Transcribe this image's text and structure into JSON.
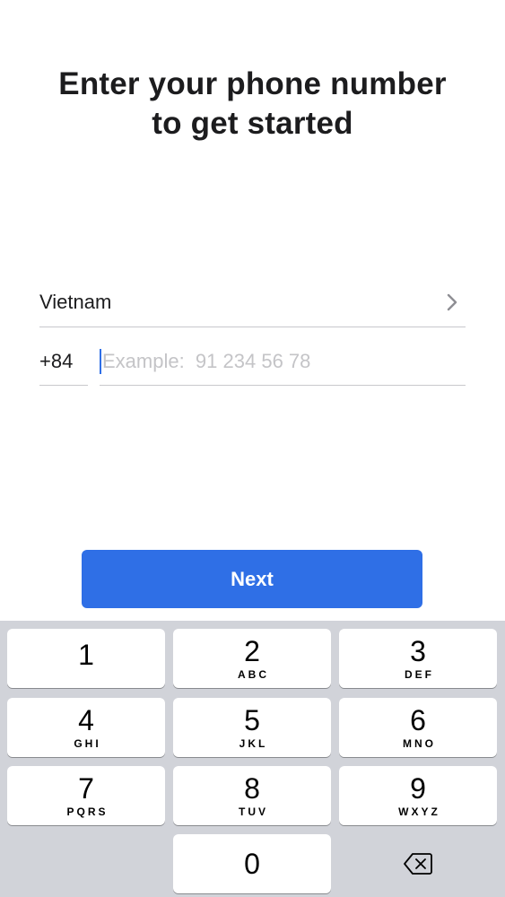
{
  "header": {
    "title_line1": "Enter your phone number",
    "title_line2": "to get started"
  },
  "country": {
    "name": "Vietnam",
    "chevron_icon": "chevron-right-icon"
  },
  "phone": {
    "country_code": "+84",
    "value": "",
    "placeholder": "Example:  91 234 56 78"
  },
  "actions": {
    "next_label": "Next"
  },
  "colors": {
    "accent": "#2f6fe6",
    "keyboard_bg": "#d1d3d9"
  },
  "keyboard": {
    "keys": [
      {
        "num": "1",
        "letters": ""
      },
      {
        "num": "2",
        "letters": "ABC"
      },
      {
        "num": "3",
        "letters": "DEF"
      },
      {
        "num": "4",
        "letters": "GHI"
      },
      {
        "num": "5",
        "letters": "JKL"
      },
      {
        "num": "6",
        "letters": "MNO"
      },
      {
        "num": "7",
        "letters": "PQRS"
      },
      {
        "num": "8",
        "letters": "TUV"
      },
      {
        "num": "9",
        "letters": "WXYZ"
      },
      {
        "num": "0",
        "letters": ""
      }
    ],
    "delete_icon": "backspace-icon"
  }
}
